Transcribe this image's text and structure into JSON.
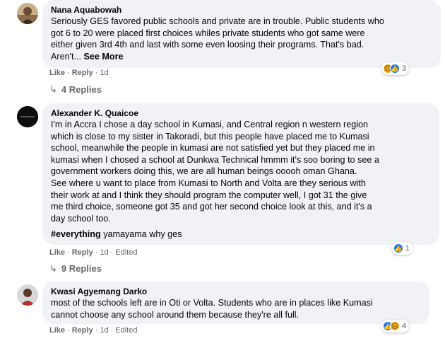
{
  "comments": [
    {
      "author": "Nana Aquabowah",
      "lines": [
        "Seriously GES favored public schools and private are in trouble. Public students who",
        "got 6 to 20 were placed first choices whiles private students who got same were",
        "either given 3rd 4th and last with some even loosing their programs. That's bad.",
        "Aren't..."
      ],
      "see_more": "See More",
      "like": "Like",
      "reply": "Reply",
      "time": "1d",
      "reaction_count": "3",
      "replies_label": "4 Replies"
    },
    {
      "author": "Alexander K. Quaicoe",
      "lines": [
        "I'm in Accra I chose a day school in Kumasi, and Central region n western region",
        "which is close to my sister in Takoradi, but this people have placed me to Kumasi",
        "school, meanwhile the people in kumasi are not satisfied yet but they placed me in",
        "kumasi when I chosed a school at Dunkwa Technical hmmm it's soo boring to see a",
        "government workers doing this, we are all human beings ooooh oman Ghana.",
        "See where u want to place from Kumasi to North and Volta are they serious with",
        "their work at and I think they should program the computer well, I got 31 the give",
        "me third choice, someone got 35 and got her second choice look at this, and it's a",
        "day school too."
      ],
      "tag": "#everything",
      "tag_rest": " yamayama why ges",
      "like": "Like",
      "reply": "Reply",
      "time": "1d",
      "edited": "Edited",
      "reaction_count": "1",
      "replies_label": "9 Replies"
    },
    {
      "author": "Kwasi Agyemang Darko",
      "lines": [
        "most of the schools left are in Oti or Volta. Students who are in places like Kumasi",
        "cannot choose any school around them because they're all full."
      ],
      "like": "Like",
      "reply": "Reply",
      "time": "1d",
      "edited": "Edited",
      "reaction_count": "4"
    }
  ],
  "colors": {
    "bubble": "#f0f2f5",
    "meta": "#65676b",
    "like_blue": "#1877f2",
    "sad_yellow": "#f7b125"
  },
  "icons": [
    "like-icon",
    "sad-icon",
    "reply-arrow-icon"
  ]
}
